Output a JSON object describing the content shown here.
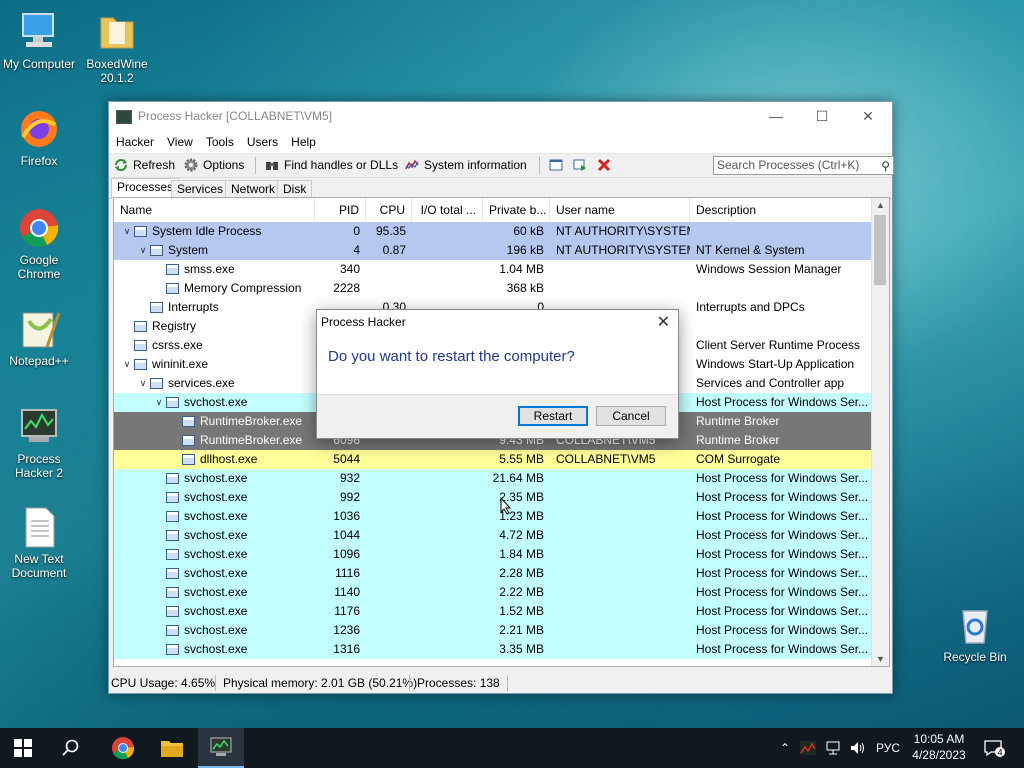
{
  "desktop": {
    "icons": [
      {
        "label": "My Computer",
        "icon": "computer-icon"
      },
      {
        "label": "BoxedWine 20.1.2",
        "icon": "folder-icon"
      },
      {
        "label": "Firefox",
        "icon": "firefox-icon"
      },
      {
        "label": "Google Chrome",
        "icon": "chrome-icon"
      },
      {
        "label": "Notepad++",
        "icon": "notepad-icon"
      },
      {
        "label": "Process Hacker 2",
        "icon": "process-hacker-icon"
      },
      {
        "label": "New Text Document",
        "icon": "text-document-icon"
      },
      {
        "label": "Recycle Bin",
        "icon": "recycle-bin-icon"
      }
    ]
  },
  "window": {
    "title": "Process Hacker [COLLABNET\\VM5]",
    "menu": [
      "Hacker",
      "View",
      "Tools",
      "Users",
      "Help"
    ],
    "toolbar": {
      "refresh": "Refresh",
      "options": "Options",
      "find_handles": "Find handles or DLLs",
      "system_info": "System information",
      "search_placeholder": "Search Processes (Ctrl+K)"
    },
    "tabs": [
      "Processes",
      "Services",
      "Network",
      "Disk"
    ],
    "columns": [
      "Name",
      "PID",
      "CPU",
      "I/O total ...",
      "Private b...",
      "User name",
      "Description"
    ],
    "rows": [
      {
        "name": "System Idle Process",
        "pid": "0",
        "cpu": "95.35",
        "io": "",
        "priv": "60 kB",
        "user": "NT AUTHORITY\\SYSTEM",
        "desc": "",
        "indent": 0,
        "tw": "v"
      },
      {
        "name": "System",
        "pid": "4",
        "cpu": "0.87",
        "io": "",
        "priv": "196 kB",
        "user": "NT AUTHORITY\\SYSTEM",
        "desc": "NT Kernel & System",
        "indent": 1,
        "tw": "v"
      },
      {
        "name": "smss.exe",
        "pid": "340",
        "cpu": "",
        "io": "",
        "priv": "1.04 MB",
        "user": "",
        "desc": "Windows Session Manager",
        "indent": 2,
        "tw": ""
      },
      {
        "name": "Memory Compression",
        "pid": "2228",
        "cpu": "",
        "io": "",
        "priv": "368 kB",
        "user": "",
        "desc": "",
        "indent": 2,
        "tw": ""
      },
      {
        "name": "Interrupts",
        "pid": "",
        "cpu": "0.30",
        "io": "",
        "priv": "0",
        "user": "",
        "desc": "Interrupts and DPCs",
        "indent": 1,
        "tw": ""
      },
      {
        "name": "Registry",
        "pid": "",
        "cpu": "",
        "io": "",
        "priv": "",
        "user": "",
        "desc": "",
        "indent": 0,
        "tw": ""
      },
      {
        "name": "csrss.exe",
        "pid": "",
        "cpu": "",
        "io": "",
        "priv": "",
        "user": "",
        "desc": "Client Server Runtime Process",
        "indent": 0,
        "tw": ""
      },
      {
        "name": "wininit.exe",
        "pid": "",
        "cpu": "",
        "io": "",
        "priv": "",
        "user": "",
        "desc": "Windows Start-Up Application",
        "indent": 0,
        "tw": "v"
      },
      {
        "name": "services.exe",
        "pid": "",
        "cpu": "",
        "io": "",
        "priv": "",
        "user": "",
        "desc": "Services and Controller app",
        "indent": 1,
        "tw": "v"
      },
      {
        "name": "svchost.exe",
        "pid": "",
        "cpu": "",
        "io": "",
        "priv": "",
        "user": "",
        "desc": "Host Process for Windows Ser...",
        "indent": 2,
        "tw": "v"
      },
      {
        "name": "RuntimeBroker.exe",
        "pid": "",
        "cpu": "",
        "io": "",
        "priv": "",
        "user": "",
        "desc": "Runtime Broker",
        "indent": 3,
        "tw": ""
      },
      {
        "name": "RuntimeBroker.exe",
        "pid": "6096",
        "cpu": "",
        "io": "",
        "priv": "9.43 MB",
        "user": "COLLABNET\\VM5",
        "desc": "Runtime Broker",
        "indent": 3,
        "tw": ""
      },
      {
        "name": "dllhost.exe",
        "pid": "5044",
        "cpu": "",
        "io": "",
        "priv": "5.55 MB",
        "user": "COLLABNET\\VM5",
        "desc": "COM Surrogate",
        "indent": 3,
        "tw": ""
      },
      {
        "name": "svchost.exe",
        "pid": "932",
        "cpu": "",
        "io": "",
        "priv": "21.64 MB",
        "user": "",
        "desc": "Host Process for Windows Ser...",
        "indent": 2,
        "tw": ""
      },
      {
        "name": "svchost.exe",
        "pid": "992",
        "cpu": "",
        "io": "",
        "priv": "2.35 MB",
        "user": "",
        "desc": "Host Process for Windows Ser...",
        "indent": 2,
        "tw": ""
      },
      {
        "name": "svchost.exe",
        "pid": "1036",
        "cpu": "",
        "io": "",
        "priv": "1.23 MB",
        "user": "",
        "desc": "Host Process for Windows Ser...",
        "indent": 2,
        "tw": ""
      },
      {
        "name": "svchost.exe",
        "pid": "1044",
        "cpu": "",
        "io": "",
        "priv": "4.72 MB",
        "user": "",
        "desc": "Host Process for Windows Ser...",
        "indent": 2,
        "tw": ""
      },
      {
        "name": "svchost.exe",
        "pid": "1096",
        "cpu": "",
        "io": "",
        "priv": "1.84 MB",
        "user": "",
        "desc": "Host Process for Windows Ser...",
        "indent": 2,
        "tw": ""
      },
      {
        "name": "svchost.exe",
        "pid": "1116",
        "cpu": "",
        "io": "",
        "priv": "2.28 MB",
        "user": "",
        "desc": "Host Process for Windows Ser...",
        "indent": 2,
        "tw": ""
      },
      {
        "name": "svchost.exe",
        "pid": "1140",
        "cpu": "",
        "io": "",
        "priv": "2.22 MB",
        "user": "",
        "desc": "Host Process for Windows Ser...",
        "indent": 2,
        "tw": ""
      },
      {
        "name": "svchost.exe",
        "pid": "1176",
        "cpu": "",
        "io": "",
        "priv": "1.52 MB",
        "user": "",
        "desc": "Host Process for Windows Ser...",
        "indent": 2,
        "tw": ""
      },
      {
        "name": "svchost.exe",
        "pid": "1236",
        "cpu": "",
        "io": "",
        "priv": "2.21 MB",
        "user": "",
        "desc": "Host Process for Windows Ser...",
        "indent": 2,
        "tw": ""
      },
      {
        "name": "svchost.exe",
        "pid": "1316",
        "cpu": "",
        "io": "",
        "priv": "3.35 MB",
        "user": "",
        "desc": "Host Process for Windows Ser...",
        "indent": 2,
        "tw": ""
      }
    ],
    "status": {
      "cpu": "CPU Usage: 4.65%",
      "memory": "Physical memory: 2.01 GB (50.21%)",
      "processes": "Processes: 138"
    }
  },
  "dialog": {
    "title": "Process Hacker",
    "message": "Do you want to restart the computer?",
    "restart": "Restart",
    "cancel": "Cancel"
  },
  "taskbar": {
    "lang": "РУС",
    "time": "10:05 AM",
    "date": "4/28/2023",
    "notifications": "4"
  },
  "colors": {
    "system": "#b4c8f0",
    "service": "#c4ffff",
    "suspended": "#777777",
    "own": "#ffff99",
    "accent": "#0078d7"
  }
}
